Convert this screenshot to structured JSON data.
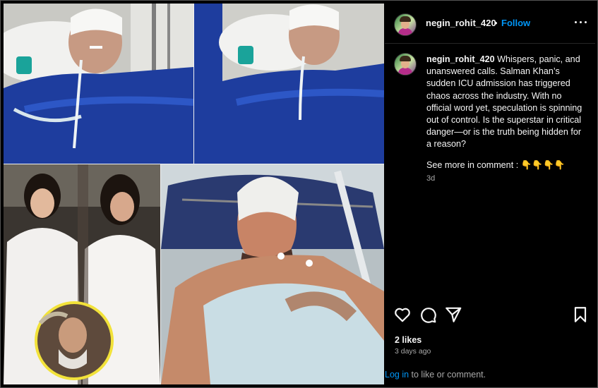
{
  "post": {
    "username": "negin_rohit_420",
    "separator": "•",
    "follow_label": "Follow",
    "caption_username": "negin_rohit_420",
    "caption_text": "Whispers, panic, and unanswered calls. Salman Khan’s sudden ICU admission has triggered chaos across the industry. With no official word yet, speculation is spinning out of control. Is the superstar in critical danger—or is the truth being hidden for a reason?",
    "see_more": "See more in comment : 👇👇👇👇",
    "caption_time": "3d",
    "likes": "2 likes",
    "posted_ago": "3 days ago",
    "login_link": "Log in",
    "login_rest": " to like or comment."
  },
  "icons": {
    "more": "more-options-icon",
    "like": "heart-icon",
    "comment": "comment-bubble-icon",
    "share": "paper-plane-icon",
    "save": "bookmark-icon"
  },
  "colors": {
    "background": "#000000",
    "text": "#f5f5f5",
    "muted": "#a8a8a8",
    "link": "#0095f6",
    "divider": "#262626"
  }
}
